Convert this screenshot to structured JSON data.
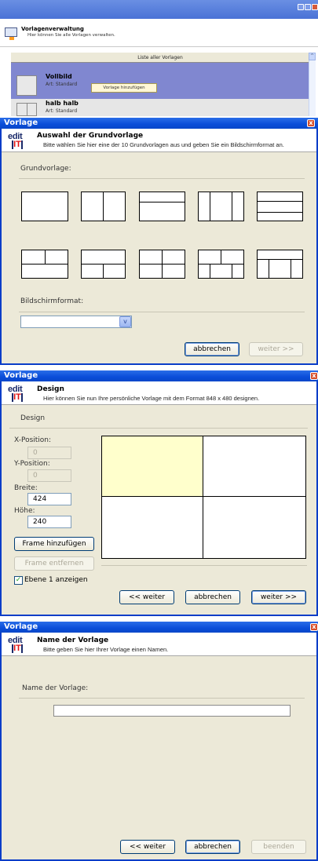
{
  "manager": {
    "title": "Vorlagenverwaltung",
    "subtitle": "Hier können Sie alle Vorlagen verwalten.",
    "list_header": "Liste aller Vorlagen",
    "items": [
      {
        "name": "Vollbild",
        "type": "Art: Standard",
        "selected": true
      },
      {
        "name": "halb halb",
        "type": "Art: Standard",
        "selected": false
      }
    ],
    "add_button": "Vorlage hinzufügen"
  },
  "dialog_base": {
    "title": "Vorlage",
    "close": "x",
    "logo_top": "edit",
    "logo_bottom": "IT"
  },
  "step1": {
    "heading": "Auswahl der Grundvorlage",
    "subtitle": "Bitte wählen Sie hier eine der 10 Grundvorlagen aus und geben Sie ein Bildschirmformat an.",
    "section_label": "Grundvorlage:",
    "format_label": "Bildschirmformat:",
    "format_value": "",
    "cancel_button": "abbrechen",
    "next_button": "weiter >>"
  },
  "step2": {
    "heading": "Design",
    "subtitle": "Hier können Sie nun Ihre persönliche Vorlage mit dem Format 848 x 480 designen.",
    "section_label": "Design",
    "x_label": "X-Position:",
    "x_value": "0",
    "y_label": "Y-Position:",
    "y_value": "0",
    "width_label": "Breite:",
    "width_value": "424",
    "height_label": "Höhe:",
    "height_value": "240",
    "add_frame_button": "Frame hinzufügen",
    "remove_frame_button": "Frame entfernen",
    "layer_checkbox_label": "Ebene 1 anzeigen",
    "layer_checked": true,
    "back_button": "<< weiter",
    "cancel_button": "abbrechen",
    "next_button": "weiter >>",
    "colors": {
      "selected_frame": "#ffffcc"
    }
  },
  "step3": {
    "heading": "Name der Vorlage",
    "subtitle": "Bitte geben Sie hier Ihrer Vorlage einen Namen.",
    "name_label": "Name der Vorlage:",
    "name_value": "",
    "back_button": "<< weiter",
    "cancel_button": "abbrechen",
    "finish_button": "beenden"
  },
  "colors": {
    "titlebar": "#0a4dd8",
    "dialog_bg": "#ece9d8",
    "selection": "#8087d0",
    "close": "#d7502c"
  }
}
